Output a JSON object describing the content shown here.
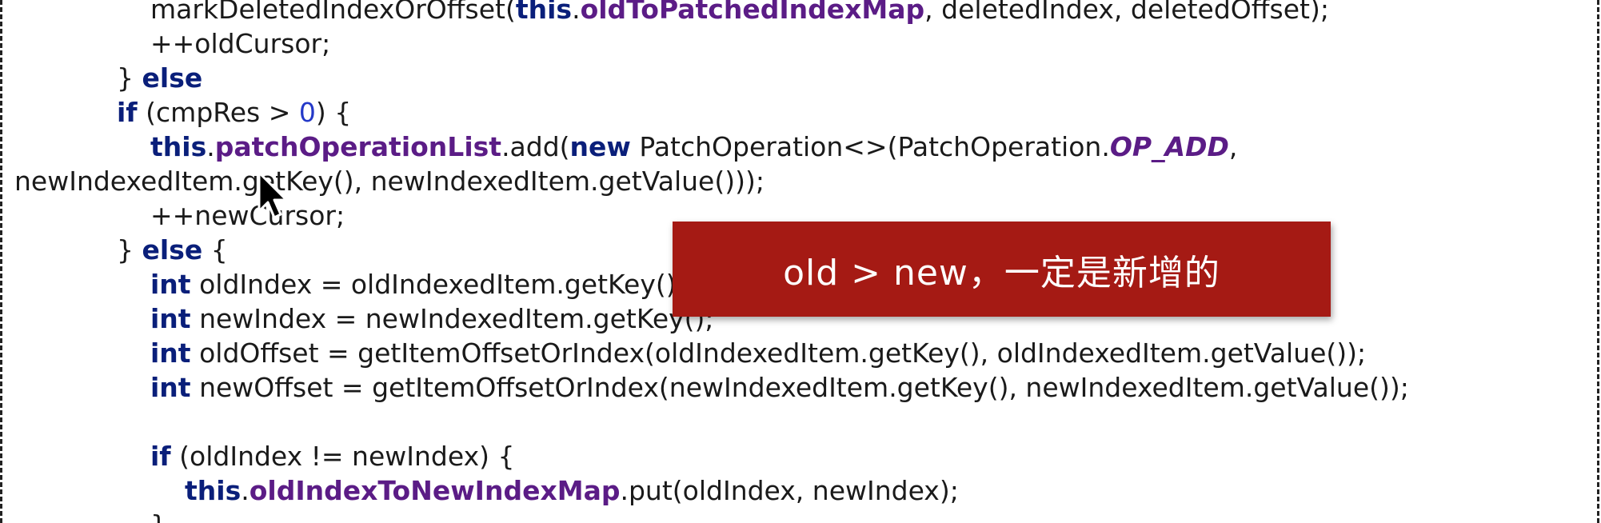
{
  "code": {
    "lines": [
      [
        "markDeletedIndexOrOffset(",
        "this",
        ".",
        "oldToPatchedIndexMap",
        ", deletedIndex, deletedOffset);"
      ],
      [
        "++oldCursor;"
      ],
      [
        "} ",
        "else"
      ],
      [
        "if",
        " (cmpRes > ",
        "0",
        ") {"
      ],
      [
        "this",
        ".",
        "patchOperationList",
        ".add(",
        "new",
        " PatchOperation<>(PatchOperation.",
        "OP_ADD",
        ","
      ],
      [
        "newIndexedItem.getKey(), newIndexedItem.getValue()));"
      ],
      [
        "++newCursor;"
      ],
      [
        "} ",
        "else",
        " {"
      ],
      [
        "int",
        " oldIndex = oldIndexedItem.getKey();"
      ],
      [
        "int",
        " newIndex = newIndexedItem.getKey();"
      ],
      [
        "int",
        " oldOffset = getItemOffsetOrIndex(oldIndexedItem.getKey(), oldIndexedItem.getValue());"
      ],
      [
        "int",
        " newOffset = getItemOffsetOrIndex(newIndexedItem.getKey(), newIndexedItem.getValue());"
      ],
      [
        "if",
        " (oldIndex != newIndex) {"
      ],
      [
        "this",
        ".",
        "oldIndexToNewIndexMap",
        ".put(oldIndex, newIndex);"
      ],
      [
        "}"
      ]
    ]
  },
  "annotation": {
    "text": "old > new，一定是新增的"
  },
  "colors": {
    "keyword": "#0a1f7a",
    "field": "#5b1c86",
    "number": "#2439c8",
    "banner": "#a51a14"
  },
  "cursor": {
    "icon": "mouse-pointer-icon"
  }
}
